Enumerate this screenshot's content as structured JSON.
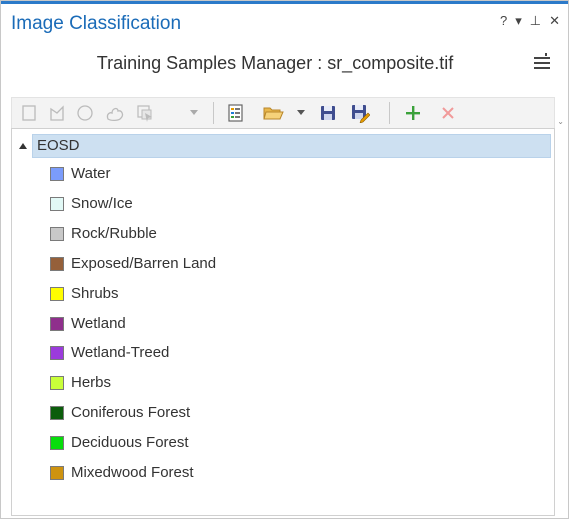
{
  "pane": {
    "title": "Image Classification",
    "controls": {
      "help": "?",
      "options": "▾",
      "pin": "⊥",
      "close": "✕"
    }
  },
  "manager": {
    "title": "Training Samples Manager : sr_composite.tif"
  },
  "toolbar": {
    "tools": [
      {
        "name": "rectangle-tool-icon",
        "enabled": false
      },
      {
        "name": "polygon-tool-icon",
        "enabled": false
      },
      {
        "name": "circle-tool-icon",
        "enabled": false
      },
      {
        "name": "freehand-tool-icon",
        "enabled": false
      },
      {
        "name": "select-segment-tool-icon",
        "enabled": false
      },
      {
        "name": "create-schema-icon",
        "enabled": true
      },
      {
        "name": "open-folder-icon",
        "enabled": true
      },
      {
        "name": "save-icon",
        "enabled": true
      },
      {
        "name": "save-as-icon",
        "enabled": true
      },
      {
        "name": "add-class-icon",
        "enabled": true
      },
      {
        "name": "remove-class-icon",
        "enabled": false
      }
    ]
  },
  "tree": {
    "root": "EOSD",
    "items": [
      {
        "label": "Water",
        "color": "#7b9cfb"
      },
      {
        "label": "Snow/Ice",
        "color": "#e2f9f6"
      },
      {
        "label": "Rock/Rubble",
        "color": "#c8c8c8"
      },
      {
        "label": "Exposed/Barren Land",
        "color": "#95603a"
      },
      {
        "label": "Shrubs",
        "color": "#fffd00"
      },
      {
        "label": "Wetland",
        "color": "#8f2f8c"
      },
      {
        "label": "Wetland-Treed",
        "color": "#9b3bdc"
      },
      {
        "label": "Herbs",
        "color": "#c9ff3a"
      },
      {
        "label": "Coniferous Forest",
        "color": "#0b5d0b"
      },
      {
        "label": "Deciduous Forest",
        "color": "#08dd0c"
      },
      {
        "label": "Mixedwood Forest",
        "color": "#ce930f"
      }
    ]
  }
}
